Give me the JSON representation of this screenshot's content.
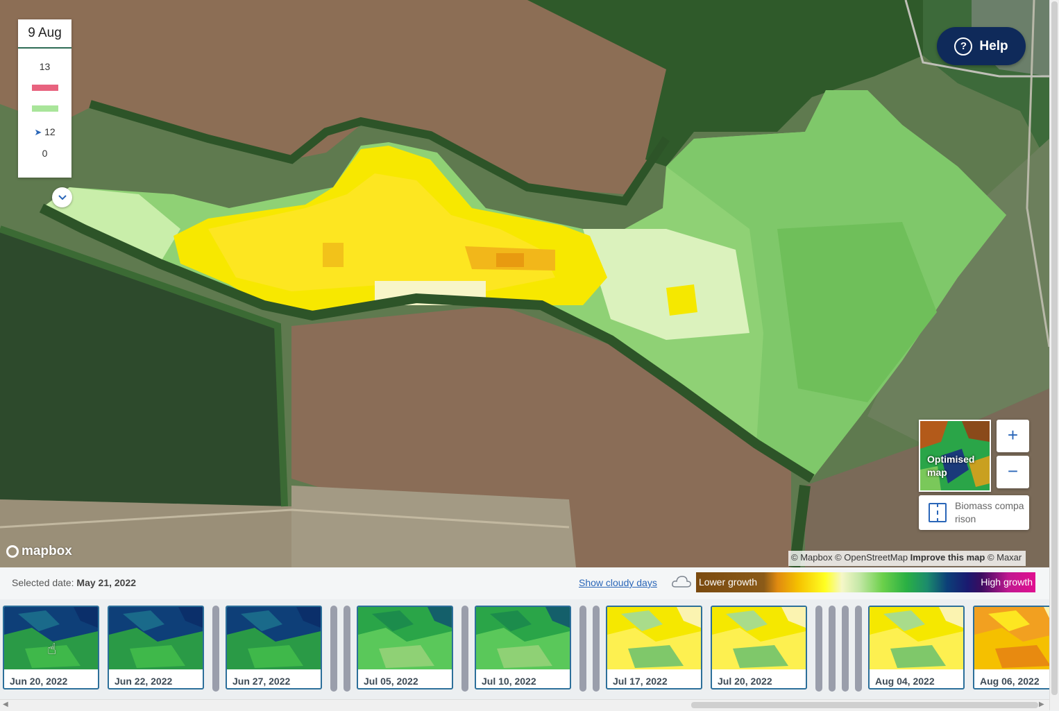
{
  "map": {
    "legend": {
      "date": "9 Aug",
      "max": "13",
      "pointer_value": "12",
      "min": "0",
      "swatch_high_color": "#e8637f",
      "swatch_low_color": "#a9e59a"
    },
    "help_label": "Help",
    "help_glyph": "?",
    "optimised_map_label": "Optimised map",
    "zoom_in_label": "+",
    "zoom_out_label": "−",
    "biomass_label": "Biomass comparison",
    "mapbox_logo": "mapbox",
    "attribution": {
      "mapbox": "© Mapbox",
      "osm": "© OpenStreetMap",
      "improve": "Improve this map",
      "maxar": "© Maxar"
    }
  },
  "bottom_bar": {
    "selected_label": "Selected date:",
    "selected_date": "May 21, 2022",
    "show_cloudy": "Show cloudy days",
    "ramp_low": "Lower growth",
    "ramp_high": "High growth"
  },
  "timeline": [
    {
      "kind": "image",
      "label": "Jun 20, 2022",
      "palette": "blue"
    },
    {
      "kind": "image",
      "label": "Jun 22, 2022",
      "palette": "blue"
    },
    {
      "kind": "cloud"
    },
    {
      "kind": "image",
      "label": "Jun 27, 2022",
      "palette": "blue"
    },
    {
      "kind": "cloud"
    },
    {
      "kind": "cloud"
    },
    {
      "kind": "image",
      "label": "Jul 05, 2022",
      "palette": "green"
    },
    {
      "kind": "cloud"
    },
    {
      "kind": "image",
      "label": "Jul 10, 2022",
      "palette": "green"
    },
    {
      "kind": "cloud"
    },
    {
      "kind": "cloud"
    },
    {
      "kind": "image",
      "label": "Jul 17, 2022",
      "palette": "yellow"
    },
    {
      "kind": "image",
      "label": "Jul 20, 2022",
      "palette": "yellow"
    },
    {
      "kind": "cloud"
    },
    {
      "kind": "cloud"
    },
    {
      "kind": "cloud"
    },
    {
      "kind": "cloud"
    },
    {
      "kind": "image",
      "label": "Aug 04, 2022",
      "palette": "yellow"
    },
    {
      "kind": "image",
      "label": "Aug 06, 2022",
      "palette": "orange"
    }
  ]
}
